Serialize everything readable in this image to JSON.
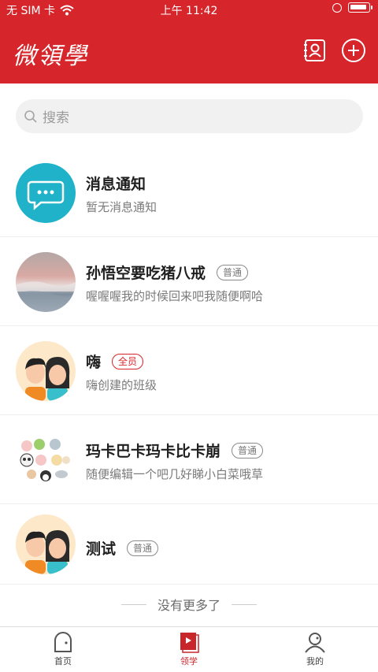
{
  "status_bar": {
    "carrier": "无 SIM 卡",
    "time": "上午 11:42"
  },
  "header": {
    "title": "微領學"
  },
  "search": {
    "placeholder": "搜索"
  },
  "conversations": [
    {
      "name": "消息通知",
      "preview": "暂无消息通知",
      "badge": "",
      "avatar": "message-bubble"
    },
    {
      "name": "孙悟空要吃猪八戒",
      "preview": "喔喔喔我的时候回来吧我随便啊哈",
      "badge": "普通",
      "avatar": "landscape"
    },
    {
      "name": "嗨",
      "preview": "嗨创建的班级",
      "badge": "全员",
      "avatar": "couple"
    },
    {
      "name": "玛卡巴卡玛卡比卡崩",
      "preview": "随便编辑一个吧几好睇小白菜哦草",
      "badge": "普通",
      "avatar": "animals"
    },
    {
      "name": "测试",
      "preview": "",
      "badge": "普通",
      "avatar": "couple"
    }
  ],
  "footer_note": "没有更多了",
  "tabs": [
    {
      "label": "首页",
      "icon": "home-icon",
      "active": false
    },
    {
      "label": "领学",
      "icon": "study-icon",
      "active": true
    },
    {
      "label": "我的",
      "icon": "profile-icon",
      "active": false
    }
  ],
  "colors": {
    "brand_red": "#d7262b",
    "notify_teal": "#1fb2c9"
  }
}
